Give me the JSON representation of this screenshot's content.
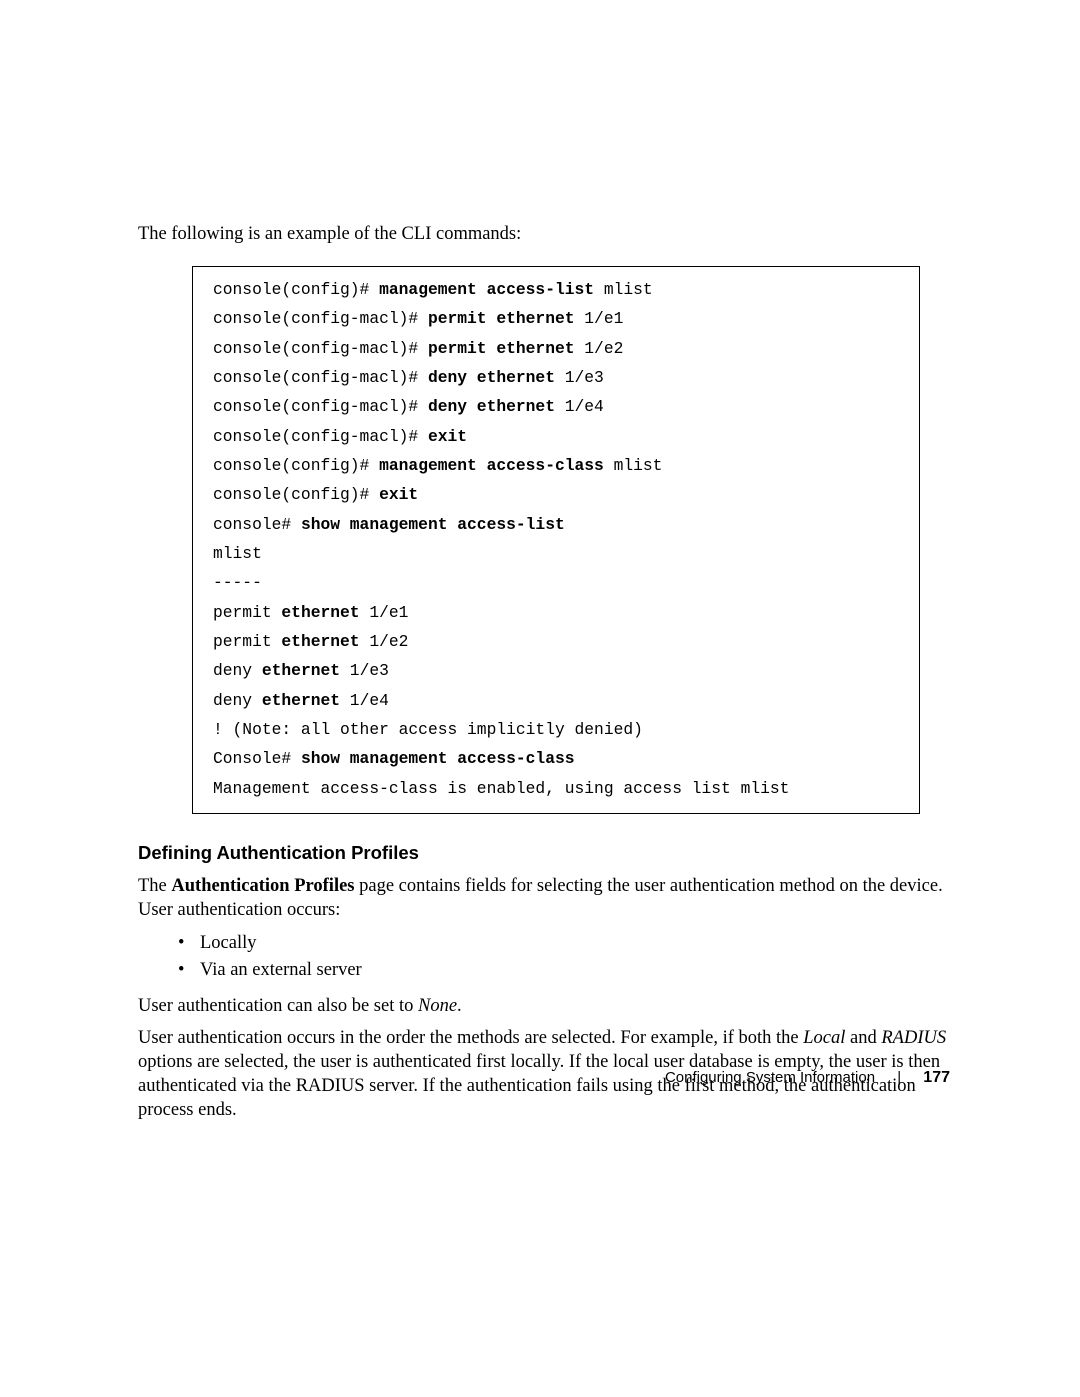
{
  "intro": "The following is an example of the CLI commands:",
  "cli": {
    "lines": [
      {
        "prefix": "console(config)# ",
        "cmd": "management access-list",
        "arg": " mlist"
      },
      {
        "prefix": "console(config-macl)# ",
        "cmd": "permit ethernet",
        "arg": " 1/e1"
      },
      {
        "prefix": "console(config-macl)# ",
        "cmd": "permit ethernet",
        "arg": " 1/e2"
      },
      {
        "prefix": "console(config-macl)# ",
        "cmd": "deny ethernet",
        "arg": " 1/e3"
      },
      {
        "prefix": "console(config-macl)# ",
        "cmd": "deny ethernet",
        "arg": " 1/e4"
      },
      {
        "prefix": "console(config-macl)# ",
        "cmd": "exit",
        "arg": ""
      },
      {
        "prefix": "console(config)# ",
        "cmd": "management access-class",
        "arg": " mlist"
      },
      {
        "prefix": "console(config)# ",
        "cmd": "exit",
        "arg": ""
      },
      {
        "prefix": "console# ",
        "cmd": "show management access-list",
        "arg": ""
      },
      {
        "prefix": "mlist",
        "cmd": "",
        "arg": ""
      },
      {
        "prefix": "-----",
        "cmd": "",
        "arg": ""
      },
      {
        "prefix": "permit ",
        "cmd": "ethernet",
        "arg": " 1/e1"
      },
      {
        "prefix": "permit ",
        "cmd": "ethernet",
        "arg": " 1/e2"
      },
      {
        "prefix": "deny ",
        "cmd": "ethernet",
        "arg": " 1/e3"
      },
      {
        "prefix": "deny ",
        "cmd": "ethernet",
        "arg": " 1/e4"
      },
      {
        "prefix": "! (Note: all other access implicitly denied)",
        "cmd": "",
        "arg": ""
      },
      {
        "prefix": "Console# ",
        "cmd": "show management access-class",
        "arg": ""
      },
      {
        "prefix": "Management access-class is enabled, using access list mlist",
        "cmd": "",
        "arg": ""
      }
    ]
  },
  "section": {
    "heading": "Defining Authentication Profiles",
    "p1_a": "The ",
    "p1_b": "Authentication Profiles",
    "p1_c": " page contains fields for selecting the user authentication method on the device. User authentication occurs:",
    "bullets": [
      "Locally",
      "Via an external server"
    ],
    "p2_a": "User authentication can also be set to ",
    "p2_b": "None",
    "p2_c": ".",
    "p3_a": "User authentication occurs in the order the methods are selected. For example, if both the ",
    "p3_b": "Local",
    "p3_c": " and ",
    "p3_d": "RADIUS",
    "p3_e": " options are selected, the user is authenticated first locally. If the local user database is empty, the user is then authenticated via the RADIUS server. If the authentication fails using the first method, the authentication process ends."
  },
  "footer": {
    "title": "Configuring System Information",
    "separator": "|",
    "page": "177"
  }
}
